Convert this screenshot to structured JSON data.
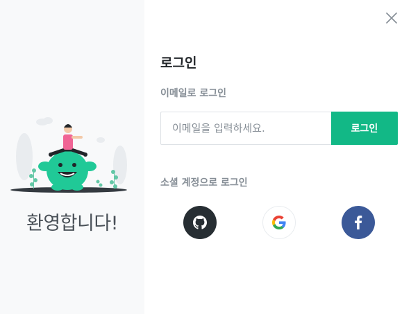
{
  "welcome_panel": {
    "welcome_text": "환영합니다!"
  },
  "login": {
    "title": "로그인",
    "email_label": "이메일로 로그인",
    "email_placeholder": "이메일을 입력하세요.",
    "email_value": "",
    "login_button_label": "로그인",
    "social_label": "소셜 계정으로 로그인"
  },
  "social": {
    "buttons": [
      {
        "icon": "github-icon",
        "color": "#272e33"
      },
      {
        "icon": "google-icon",
        "color": "#ffffff"
      },
      {
        "icon": "facebook-icon",
        "color": "#3b5998"
      }
    ]
  },
  "colors": {
    "accent": "#12b886",
    "left_panel_bg": "#f8f9fa",
    "github": "#272e33",
    "facebook": "#3b5998"
  },
  "icons": {
    "close": "close-icon"
  }
}
